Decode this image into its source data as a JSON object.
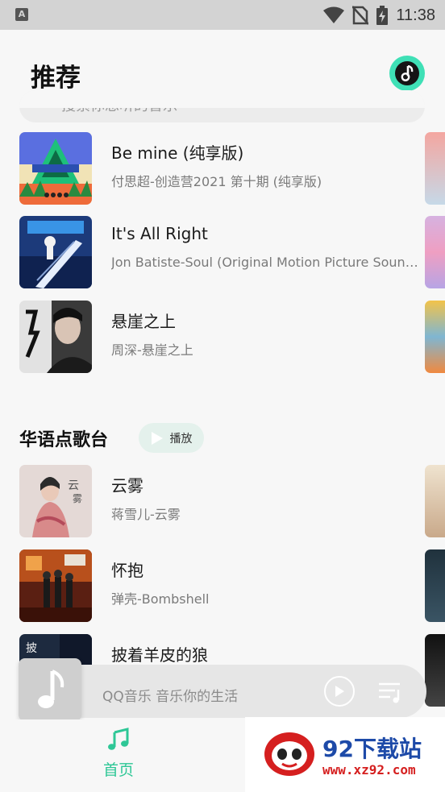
{
  "status_bar": {
    "app_icon_letter": "A",
    "time": "11:38"
  },
  "header": {
    "title": "推荐"
  },
  "search": {
    "placeholder": "搜索你想听的音乐"
  },
  "recommend_songs": [
    {
      "title": "Be mine (纯享版)",
      "subtitle": "付思超-创造营2021 第十期 (纯享版)"
    },
    {
      "title": "It's All Right",
      "subtitle": "Jon Batiste-Soul (Original Motion Picture Soundtrack)"
    },
    {
      "title": "悬崖之上",
      "subtitle": "周深-悬崖之上"
    }
  ],
  "section": {
    "title": "华语点歌台",
    "play_label": "播放"
  },
  "section_songs": [
    {
      "title": "云雾",
      "subtitle": "蒋雪儿-云雾"
    },
    {
      "title": "怀抱",
      "subtitle": "弹壳-Bombshell"
    },
    {
      "title": "披着羊皮的狼",
      "subtitle": ""
    }
  ],
  "mini_player": {
    "text": "QQ音乐 音乐你的生活"
  },
  "bottom_nav": {
    "home_label": "首页"
  },
  "watermark": {
    "brand": "92下载站",
    "url": "www.xz92.com"
  },
  "colors": {
    "accent": "#2ec796",
    "avatar_bg": "#3fe0b6"
  }
}
